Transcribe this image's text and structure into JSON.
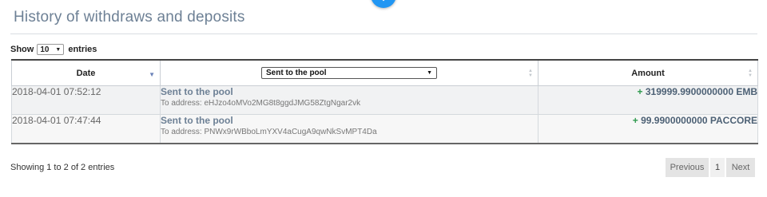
{
  "page": {
    "title": "History of withdraws and deposits"
  },
  "length_control": {
    "prefix": "Show",
    "value": "10",
    "suffix": "entries"
  },
  "table": {
    "columns": {
      "date": "Date",
      "type_filter": "Sent to the pool",
      "amount": "Amount"
    },
    "rows": [
      {
        "date": "2018-04-01 07:52:12",
        "title": "Sent to the pool",
        "address": "To address: eHJzo4oMVo2MG8t8ggdJMG58ZtgNgar2vk",
        "sign": "+",
        "amount": "319999.9900000000 EMB"
      },
      {
        "date": "2018-04-01 07:47:44",
        "title": "Sent to the pool",
        "address": "To address: PNWx9rWBboLmYXV4aCugA9qwNkSvMPT4Da",
        "sign": "+",
        "amount": "99.9900000000 PACCORE"
      }
    ]
  },
  "footer": {
    "info": "Showing 1 to 2 of 2 entries",
    "pagination": {
      "previous": "Previous",
      "current_page": "1",
      "next": "Next"
    }
  },
  "icons": {
    "fab": "chevron-down-icon",
    "sort_date": "sort-desc-icon",
    "sort_other": "sort-both-icon"
  },
  "colors": {
    "accent": "#2196f3",
    "title": "#6d8095",
    "positive": "#2f9a4e"
  }
}
